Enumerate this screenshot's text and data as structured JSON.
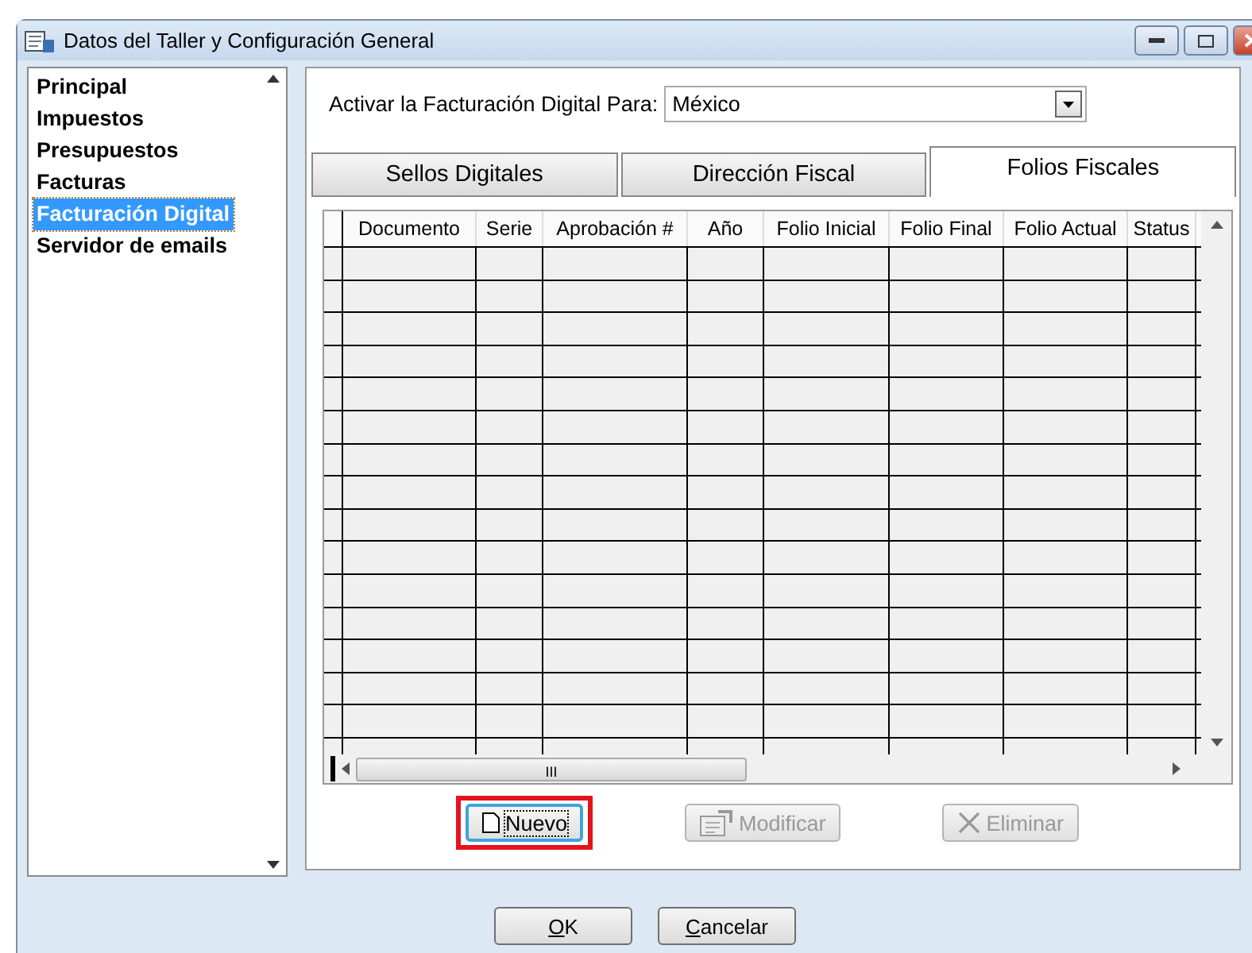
{
  "window": {
    "title": "Datos del Taller y Configuración General"
  },
  "sidebar": {
    "items": [
      {
        "label": "Principal",
        "selected": false
      },
      {
        "label": "Impuestos",
        "selected": false
      },
      {
        "label": "Presupuestos",
        "selected": false
      },
      {
        "label": "Facturas",
        "selected": false
      },
      {
        "label": "Facturación Digital",
        "selected": true
      },
      {
        "label": "Servidor de emails",
        "selected": false
      }
    ]
  },
  "country": {
    "label": "Activar la Facturación Digital Para:",
    "value": "México"
  },
  "tabs": [
    {
      "label": "Sellos Digitales",
      "selected": false
    },
    {
      "label": "Dirección Fiscal",
      "selected": false
    },
    {
      "label": "Folios Fiscales",
      "selected": true
    }
  ],
  "table": {
    "columns": [
      "Documento",
      "Serie",
      "Aprobación #",
      "Año",
      "Folio Inicial",
      "Folio Final",
      "Folio Actual",
      "Status"
    ],
    "scroll_thumb": "III"
  },
  "actions": [
    {
      "label": "Nuevo",
      "kind": "new",
      "disabled": false,
      "highlighted": true
    },
    {
      "label": "Modificar",
      "kind": "edit",
      "disabled": true,
      "highlighted": false
    },
    {
      "label": "Eliminar",
      "kind": "delete",
      "disabled": true,
      "highlighted": false
    }
  ],
  "buttons": [
    {
      "label": "OK",
      "mnemonic": true
    },
    {
      "label": "Cancelar",
      "mnemonic": true
    }
  ]
}
